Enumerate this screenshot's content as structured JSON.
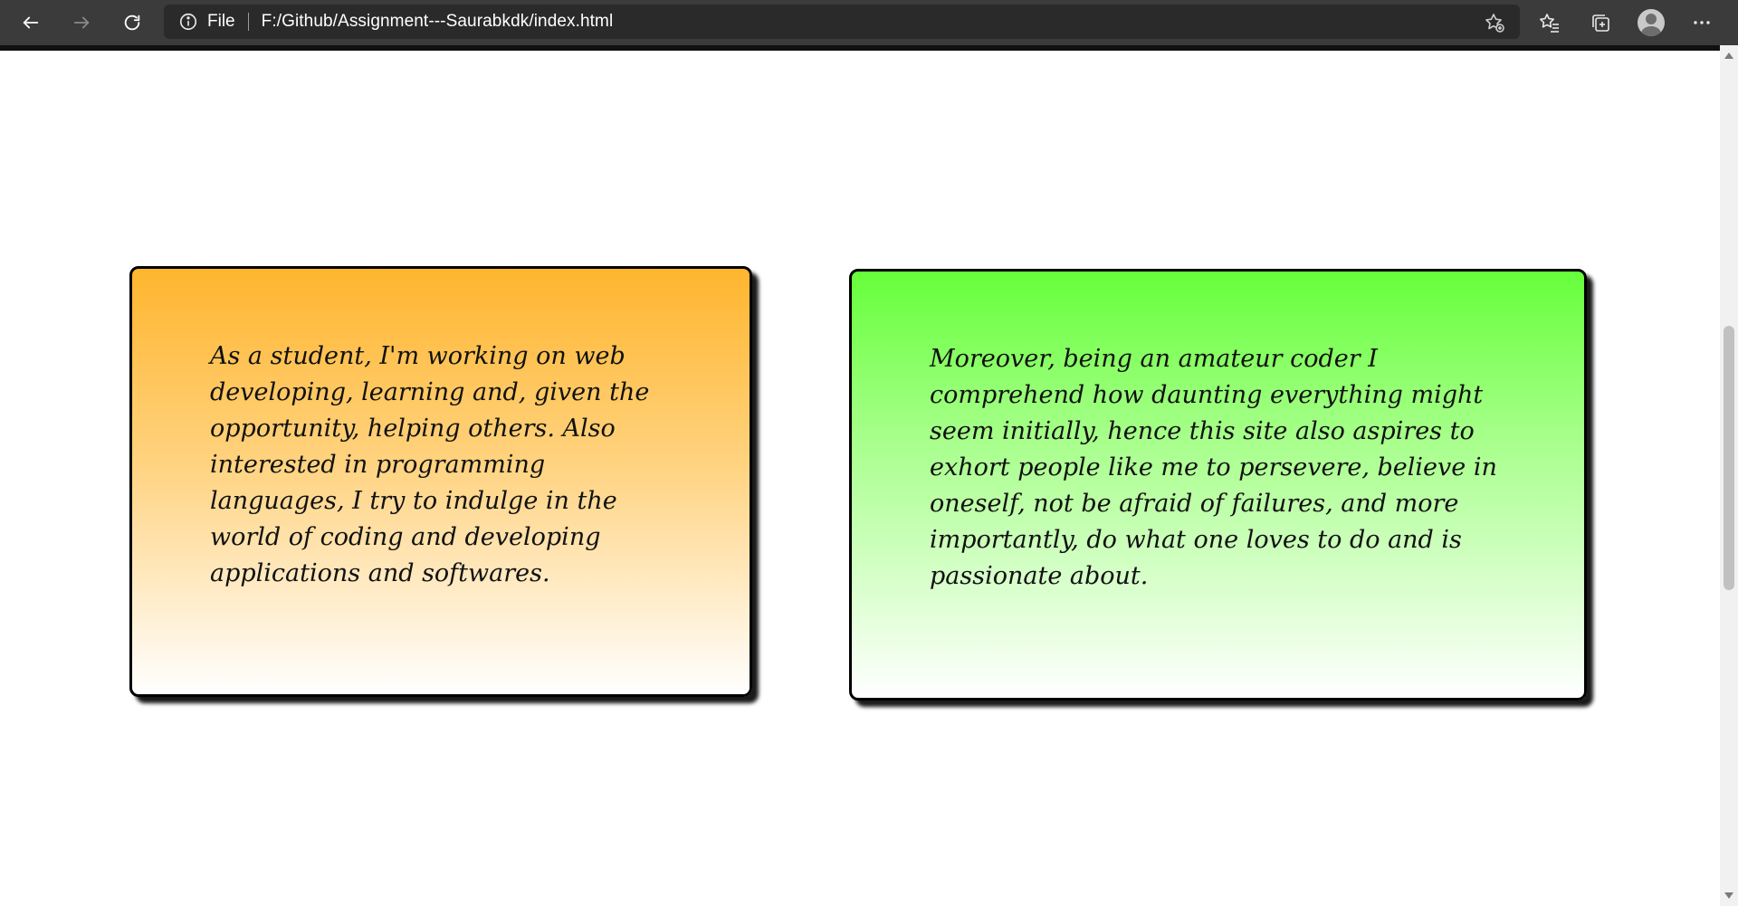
{
  "browser": {
    "scheme_label": "File",
    "url": "F:/Github/Assignment---Saurabkdk/index.html",
    "icons": {
      "back": "arrow-left-icon",
      "forward": "arrow-right-icon",
      "refresh": "refresh-icon",
      "info": "info-icon",
      "add_favorite": "star-add-icon",
      "favorites": "favorites-icon",
      "collections": "collections-icon",
      "profile": "avatar",
      "menu": "more-icon"
    }
  },
  "cards": [
    {
      "text": "As a student, I'm working on web developing, learning and, given the opportunity, helping others. Also interested in programming languages, I try to indulge in the world of coding and developing applications and softwares.",
      "gradient_top": "#ffb52e",
      "gradient_bottom": "#ffffff"
    },
    {
      "text": "Moreover, being an amateur coder I comprehend how daunting everything might seem initially, hence this site also aspires to exhort people like me to persevere, believe in oneself, not be afraid of failures, and more importantly, do what one loves to do and is passionate about.",
      "gradient_top": "#66ff3a",
      "gradient_bottom": "#ffffff"
    }
  ]
}
